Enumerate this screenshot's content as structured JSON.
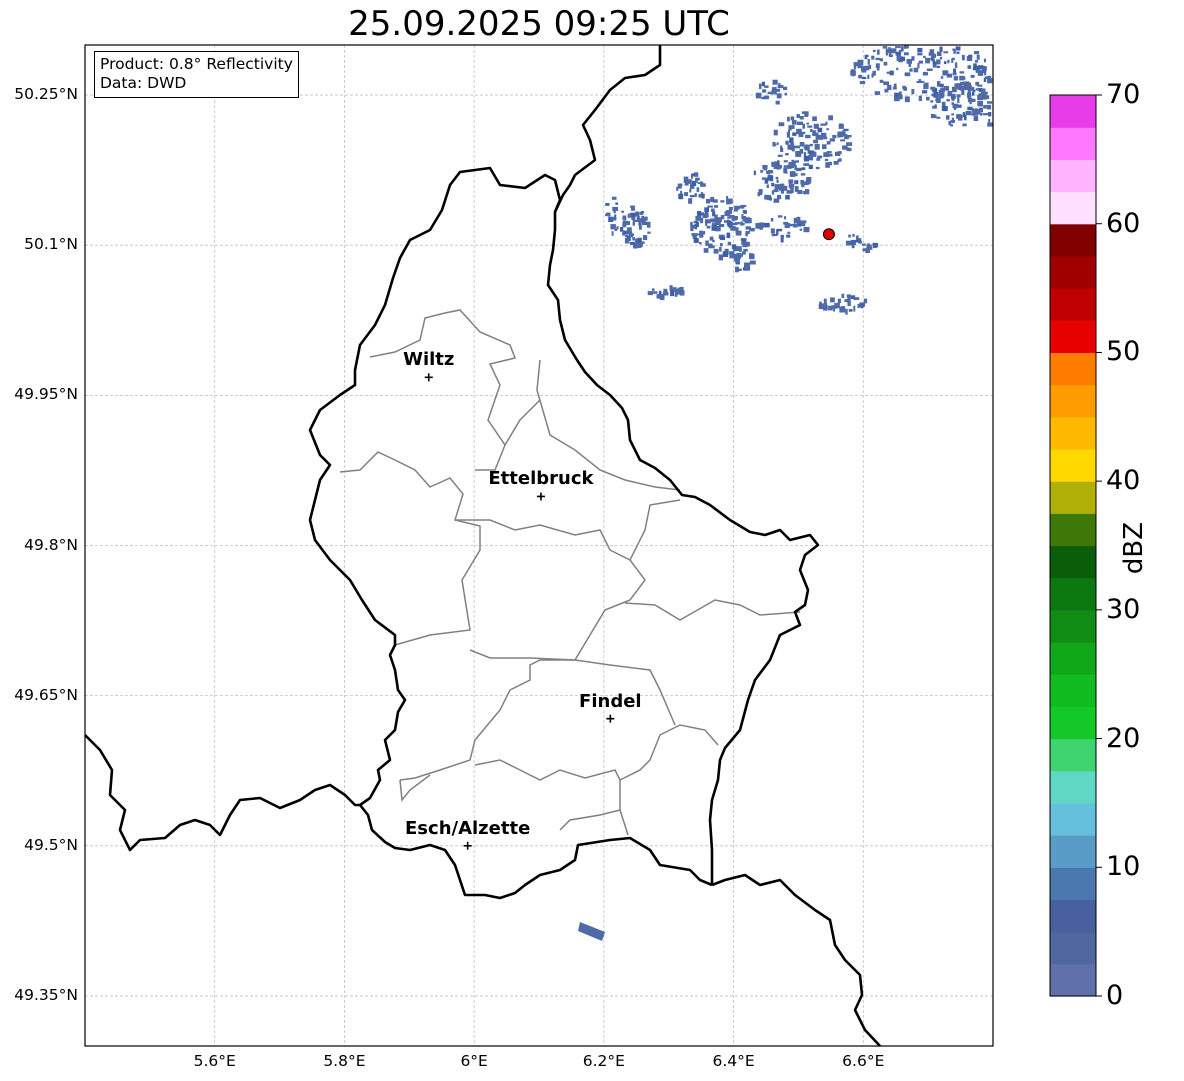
{
  "title": "25.09.2025 09:25 UTC",
  "info": {
    "product": "Product: 0.8° Reflectivity",
    "source": "Data: DWD"
  },
  "lat_ticks": [
    "50.25°N",
    "50.1°N",
    "49.95°N",
    "49.8°N",
    "49.65°N",
    "49.5°N",
    "49.35°N"
  ],
  "lon_ticks": [
    "5.6°E",
    "5.8°E",
    "6°E",
    "6.2°E",
    "6.4°E",
    "6.6°E"
  ],
  "map_extent": {
    "lon": [
      5.4,
      6.8
    ],
    "lat": [
      49.3,
      50.3
    ]
  },
  "cities": [
    {
      "name": "Wiltz",
      "lon": 5.93,
      "lat": 49.968
    },
    {
      "name": "Ettelbruck",
      "lon": 6.103,
      "lat": 49.849
    },
    {
      "name": "Findel",
      "lon": 6.21,
      "lat": 49.627
    },
    {
      "name": "Esch/Alzette",
      "lon": 5.99,
      "lat": 49.5
    }
  ],
  "radar_site": {
    "lon": 6.547,
    "lat": 50.111,
    "color": "#dd0000"
  },
  "colorbar": {
    "label": "dBZ",
    "min": 0,
    "max": 70,
    "ticks": [
      "70",
      "60",
      "50",
      "40",
      "30",
      "20",
      "10",
      "0"
    ],
    "colors": [
      "#6070a8",
      "#5068a0",
      "#4860a0",
      "#4c78b0",
      "#5a9cc8",
      "#64c0dc",
      "#60d6c4",
      "#40d470",
      "#14c828",
      "#10bc20",
      "#10a818",
      "#108c14",
      "#0c7810",
      "#0a5e0a",
      "#3e7808",
      "#b0b008",
      "#ffd800",
      "#ffba00",
      "#ff9c00",
      "#ff7c00",
      "#e80000",
      "#c00000",
      "#a00000",
      "#800000",
      "#ffe0ff",
      "#ffb4ff",
      "#ff78ff",
      "#e83ce8"
    ]
  },
  "grid": true,
  "echo_color": "#4e6aa8"
}
